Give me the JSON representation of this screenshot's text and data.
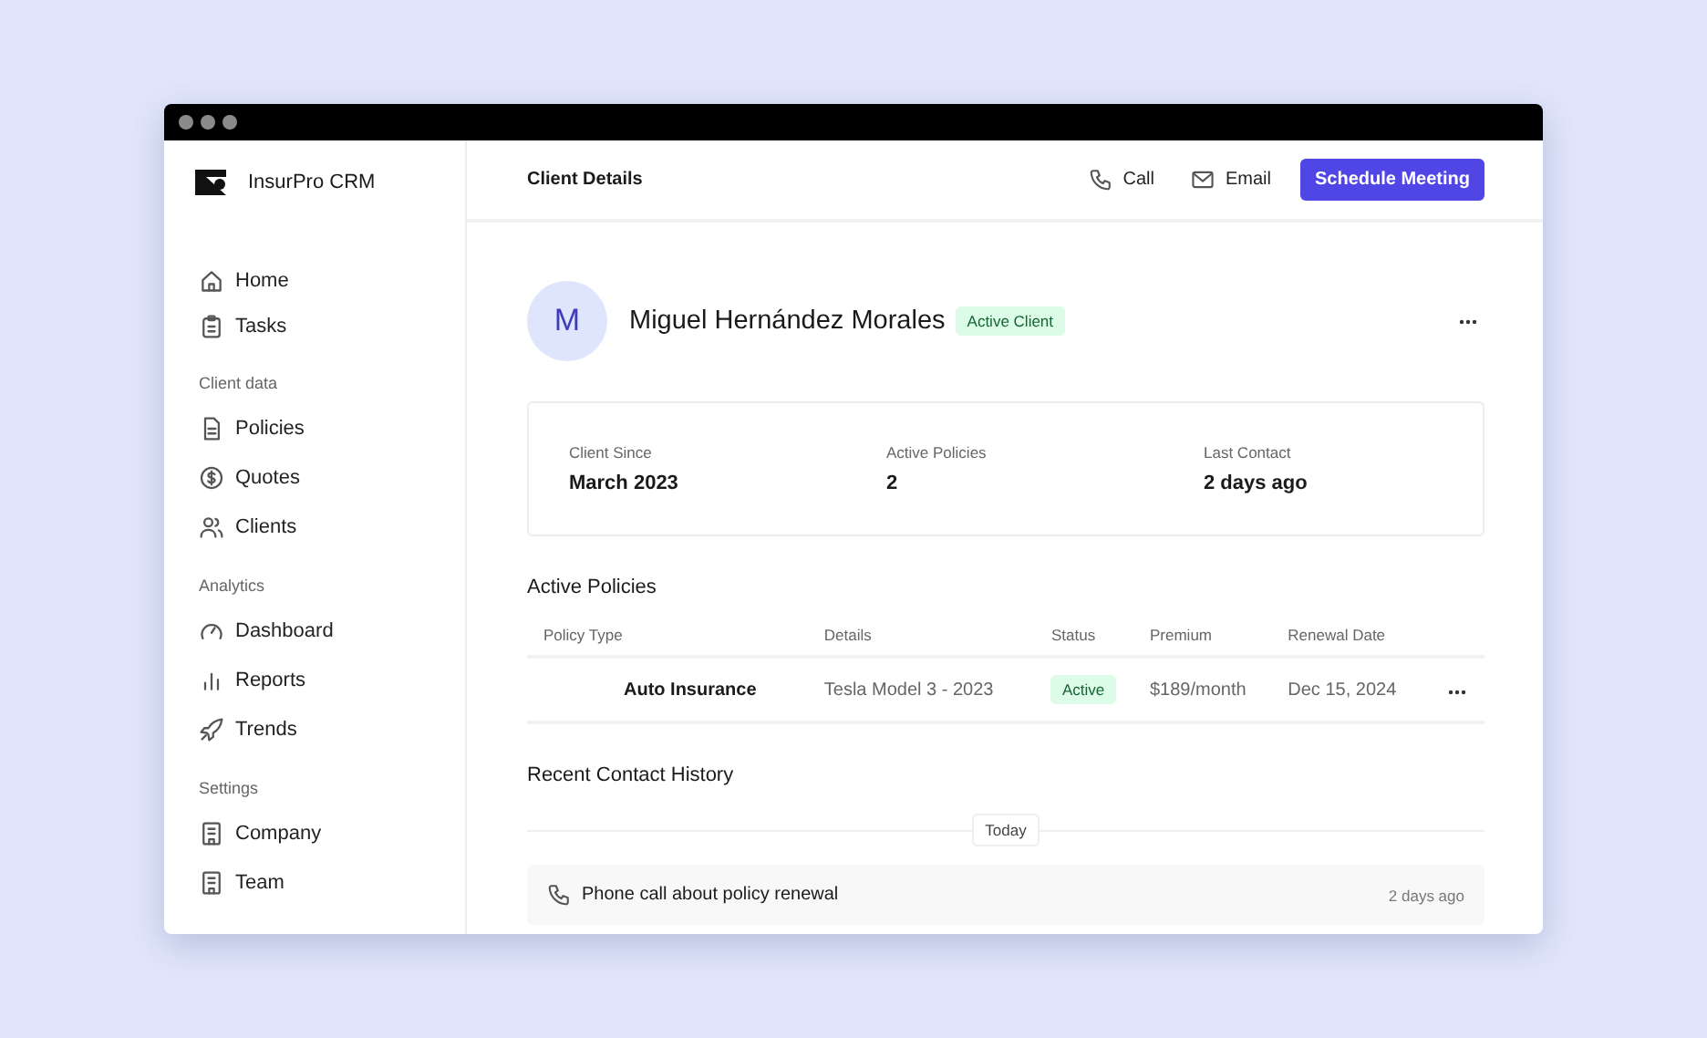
{
  "app": {
    "name": "InsurPro CRM"
  },
  "sidebar": {
    "groups": [
      {
        "items": [
          {
            "label": "Home"
          },
          {
            "label": "Tasks"
          }
        ]
      },
      {
        "heading": "Client data",
        "items": [
          {
            "label": "Policies"
          },
          {
            "label": "Quotes"
          },
          {
            "label": "Clients"
          }
        ]
      },
      {
        "heading": "Analytics",
        "items": [
          {
            "label": "Dashboard"
          },
          {
            "label": "Reports"
          },
          {
            "label": "Trends"
          }
        ]
      },
      {
        "heading": "Settings",
        "items": [
          {
            "label": "Company"
          },
          {
            "label": "Team"
          }
        ]
      }
    ]
  },
  "header": {
    "title": "Client Details",
    "actions": [
      {
        "label": "Call",
        "kind": "phone"
      },
      {
        "label": "Email",
        "kind": "mail"
      },
      {
        "label": "Schedule Meeting",
        "kind": "primary"
      }
    ]
  },
  "client": {
    "initial": "M",
    "name": "Miguel Hernández Morales",
    "badge": "Active Client"
  },
  "stats": [
    {
      "label": "Client Since",
      "value": "March 2023"
    },
    {
      "label": "Active Policies",
      "value": "2"
    },
    {
      "label": "Last Contact",
      "value": "2 days ago"
    }
  ],
  "policies": {
    "title": "Active Policies",
    "columns": [
      "Policy Type",
      "Details",
      "Status",
      "Premium",
      "Renewal Date"
    ],
    "rows": [
      {
        "type": "Auto Insurance",
        "details": "Tesla Model 3 - 2023",
        "status": "Active",
        "premium": "$189/month",
        "renewal": "Dec 15, 2024"
      }
    ]
  },
  "history": {
    "title": "Recent Contact History",
    "divider": "Today",
    "items": [
      {
        "text": "Phone call about policy renewal",
        "time": "2 days ago",
        "kind": "phone"
      }
    ]
  }
}
